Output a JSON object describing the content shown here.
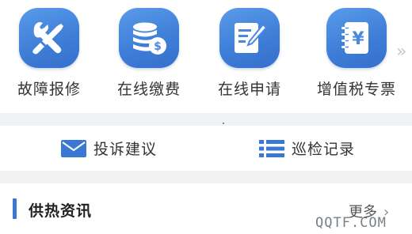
{
  "grid": {
    "items": [
      {
        "label": "故障报修",
        "icon": "wrench-screwdriver-icon"
      },
      {
        "label": "在线缴费",
        "icon": "coins-dollar-icon"
      },
      {
        "label": "在线申请",
        "icon": "form-pencil-icon"
      },
      {
        "label": "增值税专票",
        "icon": "yen-notebook-icon"
      }
    ],
    "more_glyph": "»"
  },
  "actions": [
    {
      "label": "投诉建议",
      "icon": "envelope-icon"
    },
    {
      "label": "巡检记录",
      "icon": "list-icon"
    }
  ],
  "news": {
    "title": "供热资讯",
    "more_label": "更多",
    "more_arrow": "›"
  },
  "watermark": "QQTF.COM",
  "colors": {
    "accent": "#3a78d4",
    "icon_bg": "#4a88e0",
    "separator": "#f1f2f4"
  }
}
